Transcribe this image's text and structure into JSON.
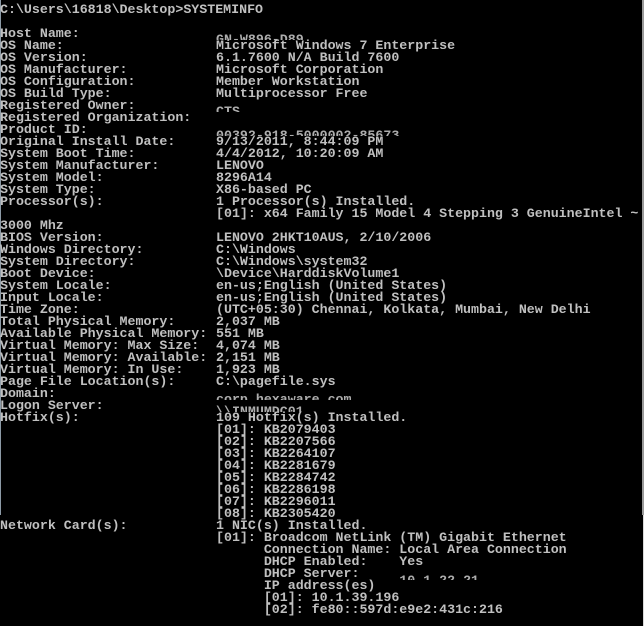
{
  "window": {
    "type": "command-prompt",
    "text_color": "#c0c0c0",
    "background_color": "#000000"
  },
  "prompt": {
    "path": "C:\\Users\\16818\\Desktop>",
    "command": "SYSTEMINFO"
  },
  "fields": [
    {
      "label": "Host Name:",
      "value": "GN-W896-D89",
      "redacted": true
    },
    {
      "label": "OS Name:",
      "value": "Microsoft Windows 7 Enterprise"
    },
    {
      "label": "OS Version:",
      "value": "6.1.7600 N/A Build 7600"
    },
    {
      "label": "OS Manufacturer:",
      "value": "Microsoft Corporation"
    },
    {
      "label": "OS Configuration:",
      "value": "Member Workstation"
    },
    {
      "label": "OS Build Type:",
      "value": "Multiprocessor Free"
    },
    {
      "label": "Registered Owner:",
      "value": "CTS",
      "redacted": true
    },
    {
      "label": "Registered Organization:",
      "value": ""
    },
    {
      "label": "Product ID:",
      "value": "00392-918-5000002-85673",
      "redacted": true
    },
    {
      "label": "Original Install Date:",
      "value": "9/13/2011, 8:44:09 PM"
    },
    {
      "label": "System Boot Time:",
      "value": "4/4/2012, 10:20:09 AM"
    },
    {
      "label": "System Manufacturer:",
      "value": "LENOVO"
    },
    {
      "label": "System Model:",
      "value": "8296A14"
    },
    {
      "label": "System Type:",
      "value": "X86-based PC"
    },
    {
      "label": "Processor(s):",
      "value": "1 Processor(s) Installed."
    },
    {
      "label": "",
      "value": "[01]: x64 Family 15 Model 4 Stepping 3 GenuineIntel ~"
    },
    {
      "label": "3000 Mhz",
      "value": ""
    },
    {
      "label": "BIOS Version:",
      "value": "LENOVO 2HKT10AUS, 2/10/2006"
    },
    {
      "label": "Windows Directory:",
      "value": "C:\\Windows"
    },
    {
      "label": "System Directory:",
      "value": "C:\\Windows\\system32"
    },
    {
      "label": "Boot Device:",
      "value": "\\Device\\HarddiskVolume1"
    },
    {
      "label": "System Locale:",
      "value": "en-us;English (United States)"
    },
    {
      "label": "Input Locale:",
      "value": "en-us;English (United States)"
    },
    {
      "label": "Time Zone:",
      "value": "(UTC+05:30) Chennai, Kolkata, Mumbai, New Delhi"
    },
    {
      "label": "Total Physical Memory:",
      "value": "2,037 MB"
    },
    {
      "label": "Available Physical Memory:",
      "value": "551 MB"
    },
    {
      "label": "Virtual Memory: Max Size:",
      "value": "4,074 MB"
    },
    {
      "label": "Virtual Memory: Available:",
      "value": "2,151 MB"
    },
    {
      "label": "Virtual Memory: In Use:",
      "value": "1,923 MB"
    },
    {
      "label": "Page File Location(s):",
      "value": "C:\\pagefile.sys"
    },
    {
      "label": "Domain:",
      "value": "corp.hexaware.com",
      "redacted": true
    },
    {
      "label": "Logon Server:",
      "value": "\\\\INMUMDC01",
      "redacted": true
    },
    {
      "label": "Hotfix(s):",
      "value": "109 Hotfix(s) Installed."
    },
    {
      "label": "",
      "value": "[01]: KB2079403"
    },
    {
      "label": "",
      "value": "[02]: KB2207566"
    },
    {
      "label": "",
      "value": "[03]: KB2264107"
    },
    {
      "label": "",
      "value": "[04]: KB2281679"
    },
    {
      "label": "",
      "value": "[05]: KB2284742"
    },
    {
      "label": "",
      "value": "[06]: KB2286198"
    },
    {
      "label": "",
      "value": "[07]: KB2296011"
    },
    {
      "label": "",
      "value": "[08]: KB2305420"
    },
    {
      "label": "Network Card(s):",
      "value": "1 NIC(s) Installed."
    },
    {
      "label": "",
      "value": "[01]: Broadcom NetLink (TM) Gigabit Ethernet"
    },
    {
      "label": "",
      "value": "      Connection Name: Local Area Connection"
    },
    {
      "label": "",
      "value": "      DHCP Enabled:    Yes"
    },
    {
      "label": "",
      "value": "      DHCP Server:     10.1.22.21",
      "redacted_from": 23
    },
    {
      "label": "",
      "value": "      IP address(es)"
    },
    {
      "label": "",
      "value": "      [01]: 10.1.39.196"
    },
    {
      "label": "",
      "value": "      [02]: fe80::597d:e9e2:431c:216"
    }
  ]
}
